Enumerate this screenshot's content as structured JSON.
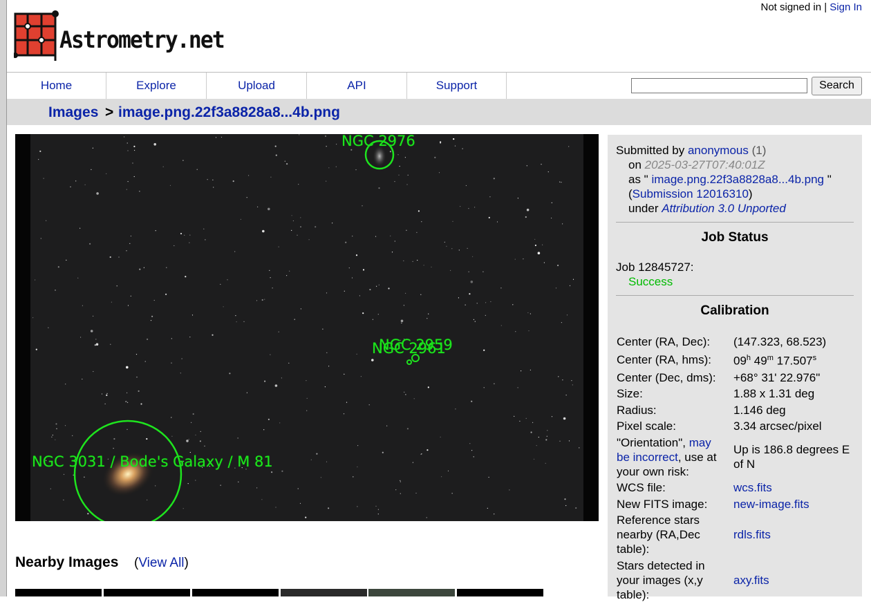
{
  "header": {
    "auth_status": "Not signed in",
    "separator": "|",
    "sign_in": "Sign In",
    "logo_text": "Astrometry.net"
  },
  "nav": {
    "items": [
      "Home",
      "Explore",
      "Upload",
      "API",
      "Support"
    ],
    "search_value": "",
    "search_button": "Search"
  },
  "breadcrumb": {
    "root": "Images",
    "separator": ">",
    "current": "image.png.22f3a8828a8...4b.png"
  },
  "image": {
    "annotations": [
      "NGC 2976",
      "NGC 2959",
      "NGC 2961",
      "NGC 3031 / Bode's Galaxy / M 81"
    ],
    "annotation_color": "#22dd22"
  },
  "nearby": {
    "heading": "Nearby Images",
    "view_all": "View All"
  },
  "submission": {
    "submitted_by_label": "Submitted by",
    "user": "anonymous",
    "user_count": "(1)",
    "on_label": "on",
    "date": "2025-03-27T07:40:01Z",
    "as_label": "as \"",
    "filename": "image.png.22f3a8828a8...4b.png",
    "as_close": "\"",
    "submission_link": "Submission 12016310",
    "under_label": "under",
    "license": "Attribution 3.0 Unported"
  },
  "job": {
    "heading": "Job Status",
    "job_label": "Job 12845727:",
    "status": "Success"
  },
  "calibration": {
    "heading": "Calibration",
    "center_radec_label": "Center (RA, Dec):",
    "center_radec": "(147.323, 68.523)",
    "center_hms_label": "Center (RA, hms):",
    "ra_h": "09",
    "ra_h_unit": "h",
    "ra_m": "49",
    "ra_m_unit": "m",
    "ra_s": "17.507",
    "ra_s_unit": "s",
    "center_dms_label": "Center (Dec, dms):",
    "center_dms": "+68° 31' 22.976\"",
    "size_label": "Size:",
    "size": "1.88 x 1.31 deg",
    "radius_label": "Radius:",
    "radius": "1.146 deg",
    "pixel_scale_label": "Pixel scale:",
    "pixel_scale": "3.34 arcsec/pixel",
    "orientation_label_1": "\"Orientation\", ",
    "orientation_link": "may be incorrect",
    "orientation_label_2": ", use at your own risk:",
    "orientation": "Up is 186.8 degrees E of N",
    "wcs_label": "WCS file:",
    "wcs_link": "wcs.fits",
    "newfits_label": "New FITS image:",
    "newfits_link": "new-image.fits",
    "rdls_label": "Reference stars nearby (RA,Dec table):",
    "rdls_link": "rdls.fits",
    "axy_label": "Stars detected in your images (x,y table):",
    "axy_link": "axy.fits"
  }
}
